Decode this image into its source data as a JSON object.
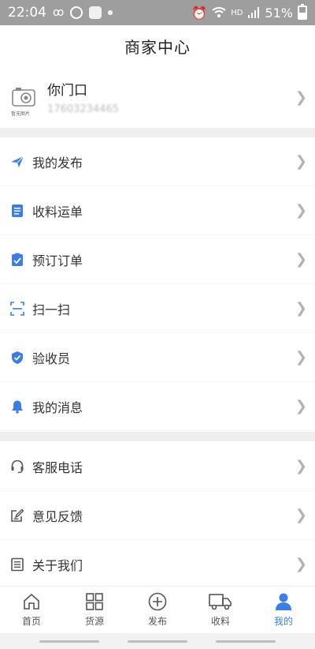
{
  "status_bar": {
    "time": "22:04",
    "network": "HD",
    "battery": "51%"
  },
  "header": {
    "title": "商家中心"
  },
  "profile": {
    "name": "你门口",
    "phone": "17603234465",
    "avatar_caption": "暂无图片"
  },
  "menu_group_1": [
    {
      "key": "publish",
      "label": "我的发布",
      "icon": "paper-plane-icon"
    },
    {
      "key": "receive-waybill",
      "label": "收料运单",
      "icon": "clipboard-list-icon"
    },
    {
      "key": "preorder",
      "label": "预订订单",
      "icon": "clipboard-check-icon"
    },
    {
      "key": "scan",
      "label": "扫一扫",
      "icon": "scan-icon"
    },
    {
      "key": "inspector",
      "label": "验收员",
      "icon": "shield-check-icon"
    },
    {
      "key": "messages",
      "label": "我的消息",
      "icon": "bell-icon"
    }
  ],
  "menu_group_2": [
    {
      "key": "service-phone",
      "label": "客服电话",
      "icon": "headset-icon"
    },
    {
      "key": "feedback",
      "label": "意见反馈",
      "icon": "edit-icon"
    },
    {
      "key": "about",
      "label": "关于我们",
      "icon": "document-icon"
    }
  ],
  "tabbar": [
    {
      "key": "home",
      "label": "首页",
      "icon": "home-icon",
      "active": false
    },
    {
      "key": "source",
      "label": "货源",
      "icon": "grid-icon",
      "active": false
    },
    {
      "key": "publish",
      "label": "发布",
      "icon": "plus-circle-icon",
      "active": false
    },
    {
      "key": "receive",
      "label": "收料",
      "icon": "truck-icon",
      "active": false
    },
    {
      "key": "mine",
      "label": "我的",
      "icon": "user-icon",
      "active": true
    }
  ],
  "colors": {
    "accent": "#3b7fe6",
    "status_bar": "#9e9e9e",
    "divider": "#efefef",
    "chevron": "#b3b3b3"
  }
}
